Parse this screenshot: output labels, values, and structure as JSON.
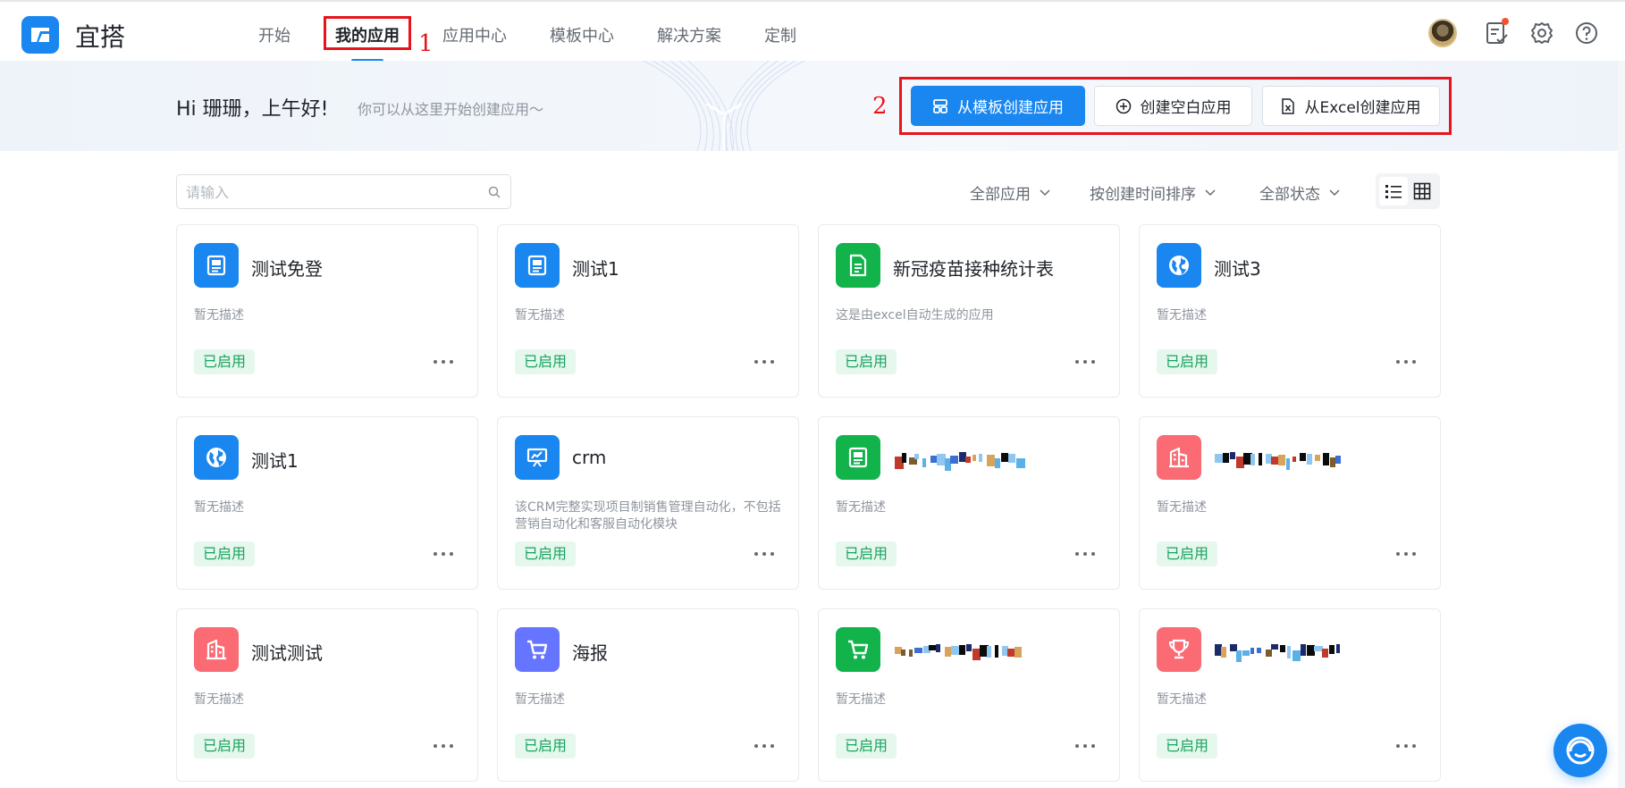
{
  "brand": {
    "name": "宜搭"
  },
  "nav": {
    "items": [
      "开始",
      "我的应用",
      "应用中心",
      "模板中心",
      "解决方案",
      "定制"
    ],
    "active": "我的应用"
  },
  "annotations": {
    "nav": "1",
    "buttons": "2",
    "color": "#e8141c"
  },
  "banner": {
    "greeting": "Hi 珊珊，上午好!",
    "subtitle": "你可以从这里开始创建应用～"
  },
  "actions": {
    "from_template": "从模板创建应用",
    "blank": "创建空白应用",
    "from_excel": "从Excel创建应用"
  },
  "search": {
    "placeholder": "请输入"
  },
  "filters": {
    "apps": "全部应用",
    "sort": "按创建时间排序",
    "status": "全部状态"
  },
  "view": {
    "active": "list-view"
  },
  "colors": {
    "primary": "#1a86f0",
    "green": "#12b34b",
    "red": "#fa6b74",
    "purple": "#6675ff",
    "status_text": "#19a35f",
    "status_bg": "#e6f7ed"
  },
  "cards": [
    {
      "name": "测试免登",
      "desc": "暂无描述",
      "status": "已启用",
      "icon": "newspaper-icon",
      "color": "#1a86f0"
    },
    {
      "name": "测试1",
      "desc": "暂无描述",
      "status": "已启用",
      "icon": "newspaper-icon",
      "color": "#1a86f0"
    },
    {
      "name": "新冠疫苗接种统计表",
      "desc": "这是由excel自动生成的应用",
      "status": "已启用",
      "icon": "document-icon",
      "color": "#12b34b"
    },
    {
      "name": "测试3",
      "desc": "暂无描述",
      "status": "已启用",
      "icon": "globe-icon",
      "color": "#1a86f0"
    },
    {
      "name": "测试1",
      "desc": "暂无描述",
      "status": "已启用",
      "icon": "globe-icon",
      "color": "#1a86f0"
    },
    {
      "name": "crm",
      "desc": "该CRM完整实现项目制销售管理自动化，不包括营销自动化和客服自动化模块",
      "status": "已启用",
      "icon": "presentation-icon",
      "color": "#1a86f0"
    },
    {
      "name": "",
      "desc": "暂无描述",
      "status": "已启用",
      "icon": "newspaper-icon",
      "color": "#12b34b"
    },
    {
      "name": "",
      "desc": "暂无描述",
      "status": "已启用",
      "icon": "building-icon",
      "color": "#fa6b74"
    },
    {
      "name": "测试测试",
      "desc": "暂无描述",
      "status": "已启用",
      "icon": "building-icon",
      "color": "#fa6b74"
    },
    {
      "name": "海报",
      "desc": "暂无描述",
      "status": "已启用",
      "icon": "cart-icon",
      "color": "#6675ff"
    },
    {
      "name": "",
      "desc": "暂无描述",
      "status": "已启用",
      "icon": "cart-icon",
      "color": "#12b34b"
    },
    {
      "name": "",
      "desc": "暂无描述",
      "status": "已启用",
      "icon": "trophy-icon",
      "color": "#fa6b74"
    }
  ]
}
